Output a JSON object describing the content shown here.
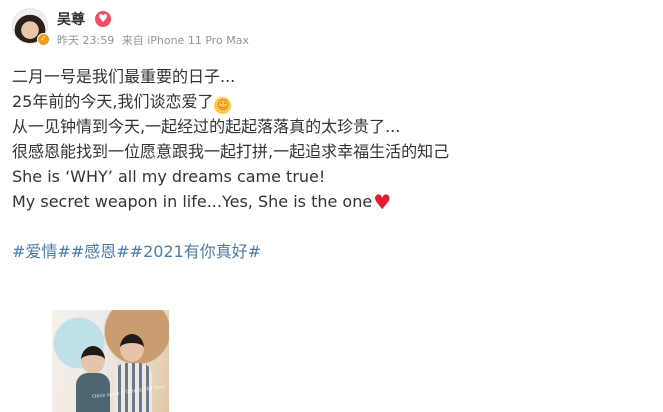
{
  "post": {
    "user": {
      "name": "吴尊",
      "vip_icon": "vip-heart-icon",
      "verified_icon": "verified-badge-icon"
    },
    "meta": {
      "time": "昨天 23:59",
      "source": "来自 iPhone 11 Pro Max"
    },
    "text_lines": [
      "二月一号是我们最重要的日子...",
      "25年前的今天,我们谈恋爱了",
      "从一见钟情到今天,一起经过的起起落落真的太珍贵了...",
      "很感恩能找到一位愿意跟我一起打拼,一起追求幸福生活的知己",
      "She is ‘WHY’ all my dreams came true!",
      "My secret weapon in life...Yes, She is the one"
    ],
    "emoji": {
      "smile": "smiling-face-with-hearts-emoji",
      "heart": "red-heart-emoji"
    },
    "hashtags": [
      "#爱情#",
      "#感恩#",
      "#2021有你真好#"
    ],
    "photo": {
      "caption": "Once upon a time in the Year",
      "mark": "♥"
    },
    "colors": {
      "text": "#333333",
      "meta": "#939393",
      "link": "#4d7ba8",
      "verified": "#f59a1b",
      "vip": "#f44d5f",
      "heart": "#e11d2f"
    }
  }
}
